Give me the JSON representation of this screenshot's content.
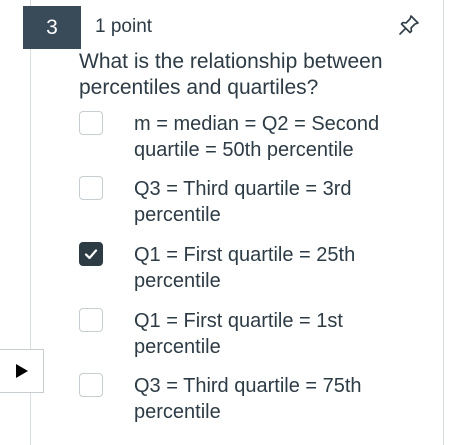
{
  "question": {
    "number": "3",
    "points": "1 point",
    "text": "What is the relationship between percentiles and quartiles?"
  },
  "icons": {
    "pin": "pushpin-icon",
    "play": "play-triangle-icon",
    "check": "checkmark-icon"
  },
  "options": [
    {
      "label": "m = median = Q2 = Second quartile = 50th percentile",
      "checked": false
    },
    {
      "label": "Q3 = Third quartile = 3rd percentile",
      "checked": false
    },
    {
      "label": "Q1 = First quartile = 25th percentile",
      "checked": true
    },
    {
      "label": "Q1 = First quartile = 1st percentile",
      "checked": false
    },
    {
      "label": "Q3 = Third quartile = 75th percentile",
      "checked": false
    }
  ],
  "colors": {
    "badge_bg": "#394b58",
    "text": "#2d3b45",
    "checked_box": "#2d3b45",
    "border": "#c7cdd1"
  }
}
